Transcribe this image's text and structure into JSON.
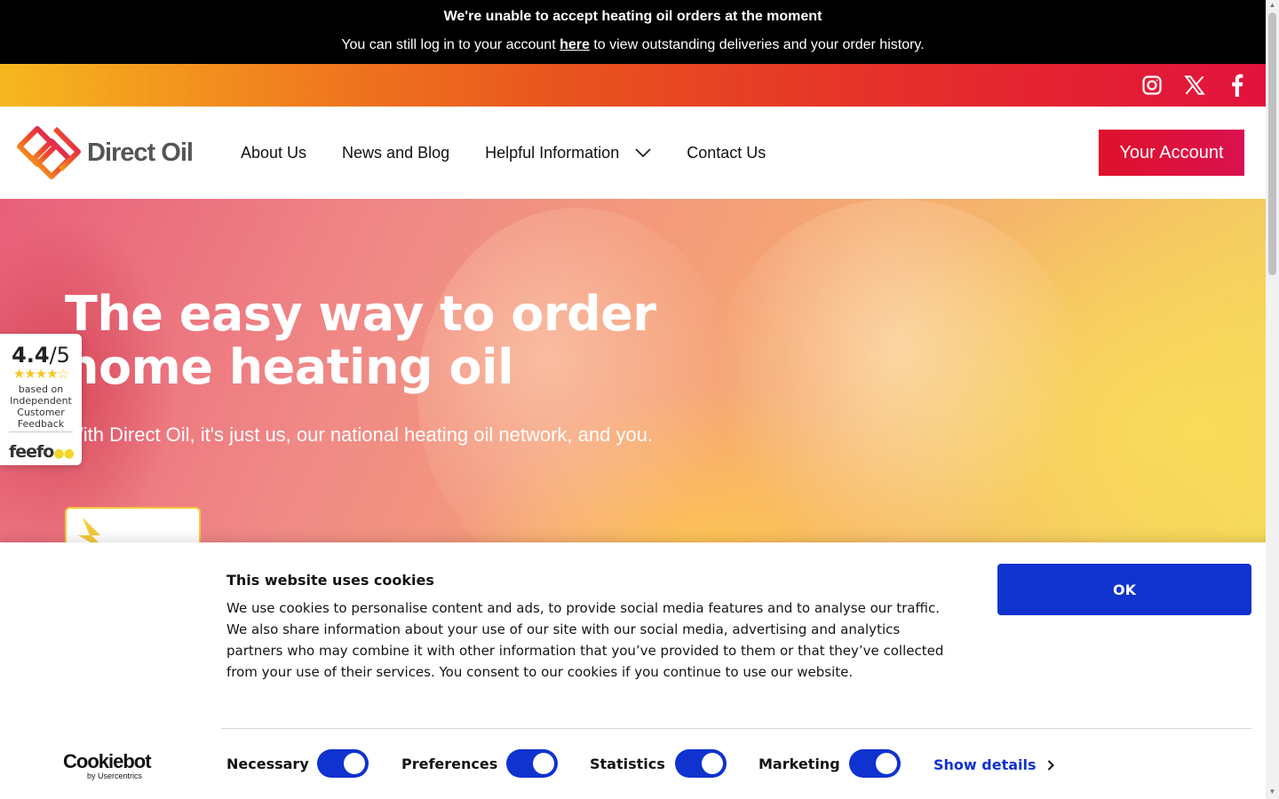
{
  "alert": {
    "line1": "We're unable to accept heating oil orders at the moment",
    "line2_before": "You can still log in to your account ",
    "line2_link": "here",
    "line2_after": " to view outstanding deliveries and your order history."
  },
  "social": {
    "icons": [
      "instagram-icon",
      "x-twitter-icon",
      "facebook-icon"
    ]
  },
  "header": {
    "logo_text": "Direct Oil",
    "nav": {
      "about": "About Us",
      "blog": "News and Blog",
      "helpful": "Helpful Information",
      "contact": "Contact Us"
    },
    "account_button": "Your Account"
  },
  "hero": {
    "title": "The easy way to order home heating oil",
    "subtitle": "With Direct Oil, it's just us, our national heating oil network, and you."
  },
  "feefo": {
    "score": "4.4",
    "out_of": "/5",
    "rating": 4.4,
    "line1": "based on",
    "line2": "Independent",
    "line3": "Customer",
    "line4": "Feedback",
    "brand": "feefo"
  },
  "cookie": {
    "title": "This website uses cookies",
    "body": "We use cookies to personalise content and ads, to provide social media features and to analyse our traffic. We also share information about your use of our site with our social media, advertising and analytics partners who may combine it with other information that you’ve provided to them or that they’ve collected from your use of their services. You consent to our cookies if you continue to use our website.",
    "ok_button": "OK",
    "brand": "Cookiebot",
    "brand_sub": "by Usercentrics",
    "toggles": {
      "necessary": "Necessary",
      "preferences": "Preferences",
      "statistics": "Statistics",
      "marketing": "Marketing"
    },
    "show_details": "Show details"
  },
  "colors": {
    "accent_red": "#e0112b",
    "cookie_blue": "#1032cf",
    "gradient_start": "#f6b81e",
    "gradient_end": "#e2123c"
  }
}
